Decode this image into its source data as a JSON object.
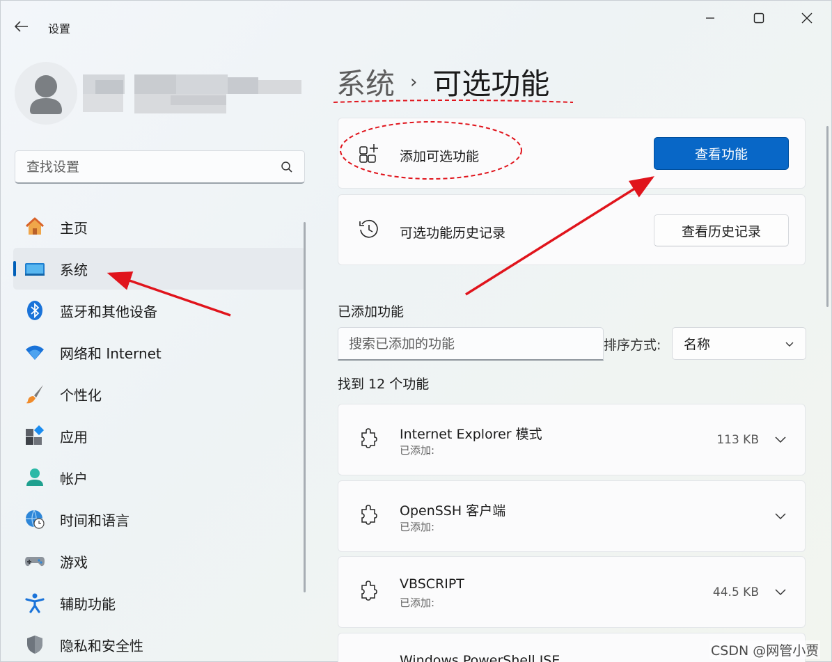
{
  "app": {
    "title": "设置"
  },
  "search": {
    "placeholder": "查找设置"
  },
  "sidebar": {
    "items": [
      {
        "label": "主页",
        "icon": "home-icon",
        "active": false
      },
      {
        "label": "系统",
        "icon": "system-display-icon",
        "active": true
      },
      {
        "label": "蓝牙和其他设备",
        "icon": "bluetooth-icon",
        "active": false
      },
      {
        "label": "网络和 Internet",
        "icon": "wifi-icon",
        "active": false
      },
      {
        "label": "个性化",
        "icon": "brush-icon",
        "active": false
      },
      {
        "label": "应用",
        "icon": "apps-icon",
        "active": false
      },
      {
        "label": "帐户",
        "icon": "account-icon",
        "active": false
      },
      {
        "label": "时间和语言",
        "icon": "globe-clock-icon",
        "active": false
      },
      {
        "label": "游戏",
        "icon": "gamepad-icon",
        "active": false
      },
      {
        "label": "辅助功能",
        "icon": "accessibility-icon",
        "active": false
      },
      {
        "label": "隐私和安全性",
        "icon": "shield-icon",
        "active": false
      }
    ]
  },
  "header": {
    "parent": "系统",
    "separator": "›",
    "current": "可选功能"
  },
  "add_card": {
    "title": "添加可选功能",
    "button": "查看功能",
    "icon": "add-apps-icon"
  },
  "history_card": {
    "title": "可选功能历史记录",
    "button": "查看历史记录",
    "icon": "history-icon"
  },
  "installed": {
    "section_title": "已添加功能",
    "filter_placeholder": "搜索已添加的功能",
    "sort_label": "排序方式:",
    "sort_value": "名称",
    "found_text": "找到 12 个功能",
    "features": [
      {
        "name": "Internet Explorer 模式",
        "status": "已添加:",
        "size": "113 KB"
      },
      {
        "name": "OpenSSH 客户端",
        "status": "已添加:",
        "size": ""
      },
      {
        "name": "VBSCRIPT",
        "status": "已添加:",
        "size": "44.5 KB"
      },
      {
        "name": "Windows PowerShell ISE",
        "status": "",
        "size": ""
      }
    ]
  },
  "watermark": "CSDN @网管小贾",
  "colors": {
    "accent": "#0867c7",
    "annotation": "#e0141c"
  }
}
